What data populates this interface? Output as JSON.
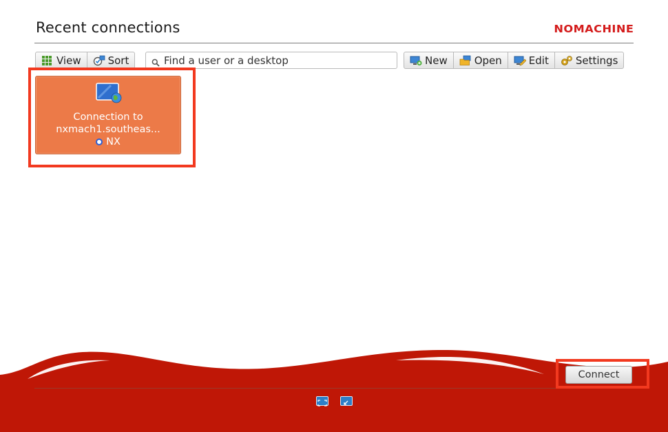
{
  "header": {
    "title": "Recent connections",
    "brand": "NOMACHINE"
  },
  "toolbar": {
    "view_label": "View",
    "sort_label": "Sort",
    "search_placeholder": "Find a user or a desktop",
    "search_value": "",
    "new_label": "New",
    "open_label": "Open",
    "edit_label": "Edit",
    "settings_label": "Settings"
  },
  "connections": [
    {
      "line1": "Connection to",
      "line2": "nxmach1.southeas...",
      "protocol": "NX",
      "icon": "remote-desktop-globe-icon",
      "selected": true
    }
  ],
  "footer": {
    "connect_label": "Connect",
    "icons": [
      "fullscreen-icon",
      "minimize-icon"
    ]
  },
  "colors": {
    "brand": "#d41c1c",
    "tile": "#ec7a48",
    "wave": "#bf1706",
    "highlight": "#f2391f",
    "protocol_dot": "#2a5fd6"
  }
}
